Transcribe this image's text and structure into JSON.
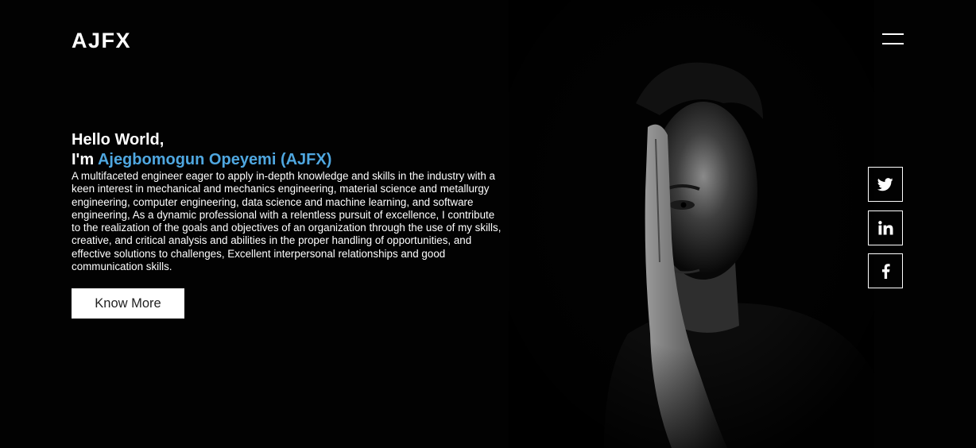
{
  "header": {
    "logo": "AJFX",
    "menu_icon": "hamburger-menu-icon"
  },
  "intro": {
    "greeting": "Hello World,",
    "im_prefix": "I'm",
    "name": "Ajegbomogun Opeyemi (AJFX)",
    "bio": "A multifaceted engineer eager to apply in-depth knowledge and skills in the industry with a keen interest in mechanical and mechanics engineering, material science and metallurgy engineering, computer engineering, data science and machine learning, and software engineering, As a dynamic professional with a relentless pursuit of excellence, I contribute to the realization of the goals and objectives of an organization through the use of my skills, creative, and critical analysis and abilities in the proper handling of opportunities, and effective solutions to challenges, Excellent interpersonal relationships and good communication skills.",
    "button_label": "Know More"
  },
  "social": [
    {
      "icon": "twitter-icon"
    },
    {
      "icon": "linkedin-icon"
    },
    {
      "icon": "facebook-icon"
    }
  ],
  "colors": {
    "background": "#000000",
    "accent": "#4fa7e0",
    "text": "#ffffff",
    "button_bg": "#ffffff",
    "button_text": "#222222"
  }
}
